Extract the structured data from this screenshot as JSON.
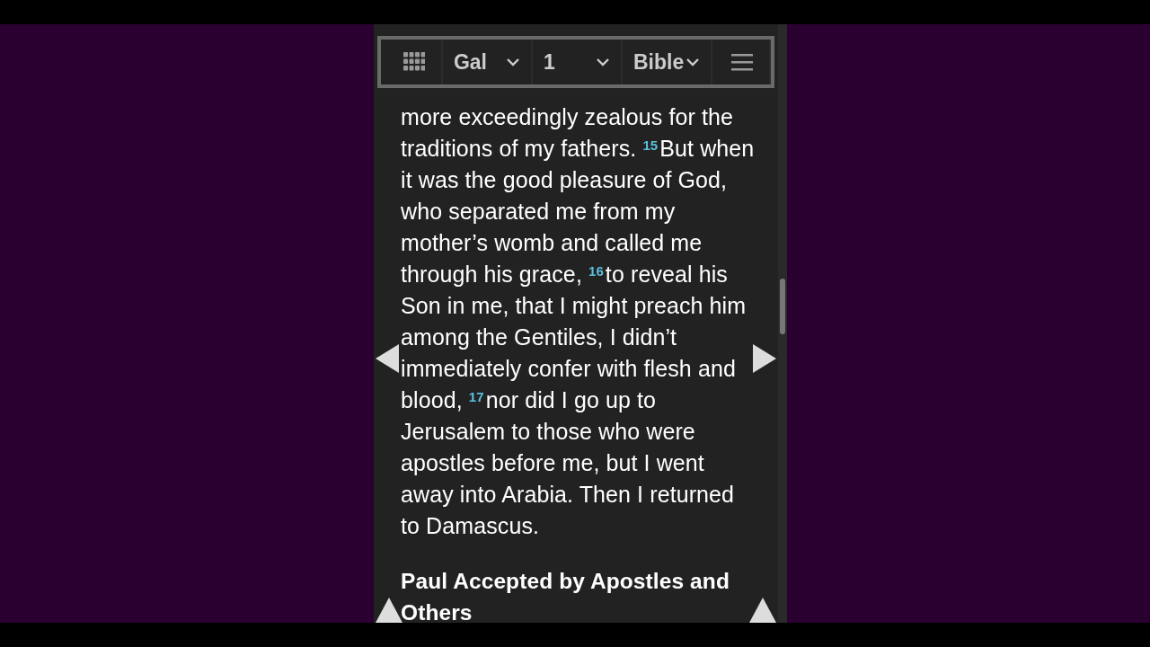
{
  "toolbar": {
    "book": "Gal",
    "chapter": "1",
    "version": "Bible"
  },
  "passage": [
    {
      "kind": "text",
      "text": "more exceedingly zealous for the traditions of my fathers. "
    },
    {
      "kind": "verse",
      "text": "15"
    },
    {
      "kind": "text",
      "text": "But when it was the good pleasure of God, who separated me from my mother’s womb and called me through his grace, "
    },
    {
      "kind": "verse",
      "text": "16"
    },
    {
      "kind": "text",
      "text": "to reveal his Son in me, that I might preach him among the Gentiles, I didn’t immediately confer with flesh and blood, "
    },
    {
      "kind": "verse",
      "text": "17"
    },
    {
      "kind": "text",
      "text": "nor did I go up to Jerusalem to those who were apostles before me, but I went away into Arabia. Then I returned to Damascus."
    }
  ],
  "heading": "Paul Accepted by Apostles and Others"
}
